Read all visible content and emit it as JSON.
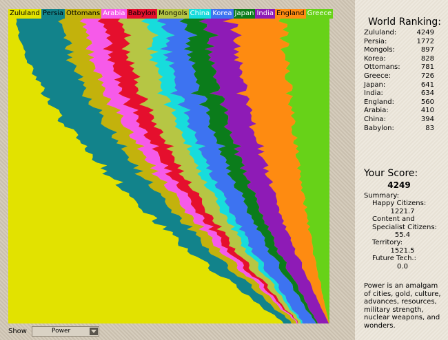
{
  "legend": [
    {
      "name": "Zululand",
      "color": "#e2e200",
      "text": "#000000"
    },
    {
      "name": "Persia",
      "color": "#12838b",
      "text": "#000000"
    },
    {
      "name": "Ottomans",
      "color": "#c3b20c",
      "text": "#000000"
    },
    {
      "name": "Arabia",
      "color": "#f65ae9",
      "text": "#ffffff"
    },
    {
      "name": "Babylon",
      "color": "#e50f2d",
      "text": "#000000"
    },
    {
      "name": "Mongols",
      "color": "#b6c644",
      "text": "#000000"
    },
    {
      "name": "China",
      "color": "#17dcdc",
      "text": "#ffffff"
    },
    {
      "name": "Korea",
      "color": "#3d73f1",
      "text": "#ffffff"
    },
    {
      "name": "Japan",
      "color": "#0b7c1b",
      "text": "#ffffff"
    },
    {
      "name": "India",
      "color": "#8e1bb6",
      "text": "#ffffff"
    },
    {
      "name": "England",
      "color": "#fe8b11",
      "text": "#000000"
    },
    {
      "name": "Greece",
      "color": "#67d218",
      "text": "#ffffff"
    }
  ],
  "chart_data": {
    "type": "area",
    "stacked": true,
    "normalized": true,
    "series_order": [
      "Zululand",
      "Persia",
      "Ottomans",
      "Arabia",
      "Babylon",
      "Mongols",
      "China",
      "Korea",
      "Japan",
      "India",
      "England",
      "Greece"
    ],
    "shares_at_start": [
      0.025,
      0.145,
      0.067,
      0.06,
      0.06,
      0.079,
      0.049,
      0.07,
      0.067,
      0.085,
      0.154,
      0.14
    ],
    "shares_at_end": [
      0.86,
      0.025,
      0.015,
      0.004,
      0.001,
      0.008,
      0.005,
      0.04,
      0.005,
      0.035,
      0.001,
      0.001
    ]
  },
  "ranking": {
    "title": "World Ranking:",
    "rows": [
      {
        "name": "Zululand:",
        "value": "4249"
      },
      {
        "name": "Persia:",
        "value": "1772"
      },
      {
        "name": "Mongols:",
        "value": "897"
      },
      {
        "name": "Korea:",
        "value": "828"
      },
      {
        "name": "Ottomans:",
        "value": "781"
      },
      {
        "name": "Greece:",
        "value": "726"
      },
      {
        "name": "Japan:",
        "value": "641"
      },
      {
        "name": "India:",
        "value": "634"
      },
      {
        "name": "England:",
        "value": "560"
      },
      {
        "name": "Arabia:",
        "value": "410"
      },
      {
        "name": "China:",
        "value": "394"
      },
      {
        "name": "Babylon:",
        "value": "83"
      }
    ]
  },
  "score": {
    "title": "Your Score:",
    "value": "4249",
    "summary_label": "Summary:",
    "happy_label": "Happy Citizens:",
    "happy_value": "1221.7",
    "content_label1": "Content and",
    "content_label2": "Specialist Citizens:",
    "content_value": "55.4",
    "territory_label": "Territory:",
    "territory_value": "1521.5",
    "future_label": "Future Tech.:",
    "future_value": "0.0"
  },
  "description": "Power is an amalgam of cities, gold, culture, advances, resources, military strength, nuclear weapons, and wonders.",
  "show": {
    "label": "Show",
    "value": "Power"
  }
}
